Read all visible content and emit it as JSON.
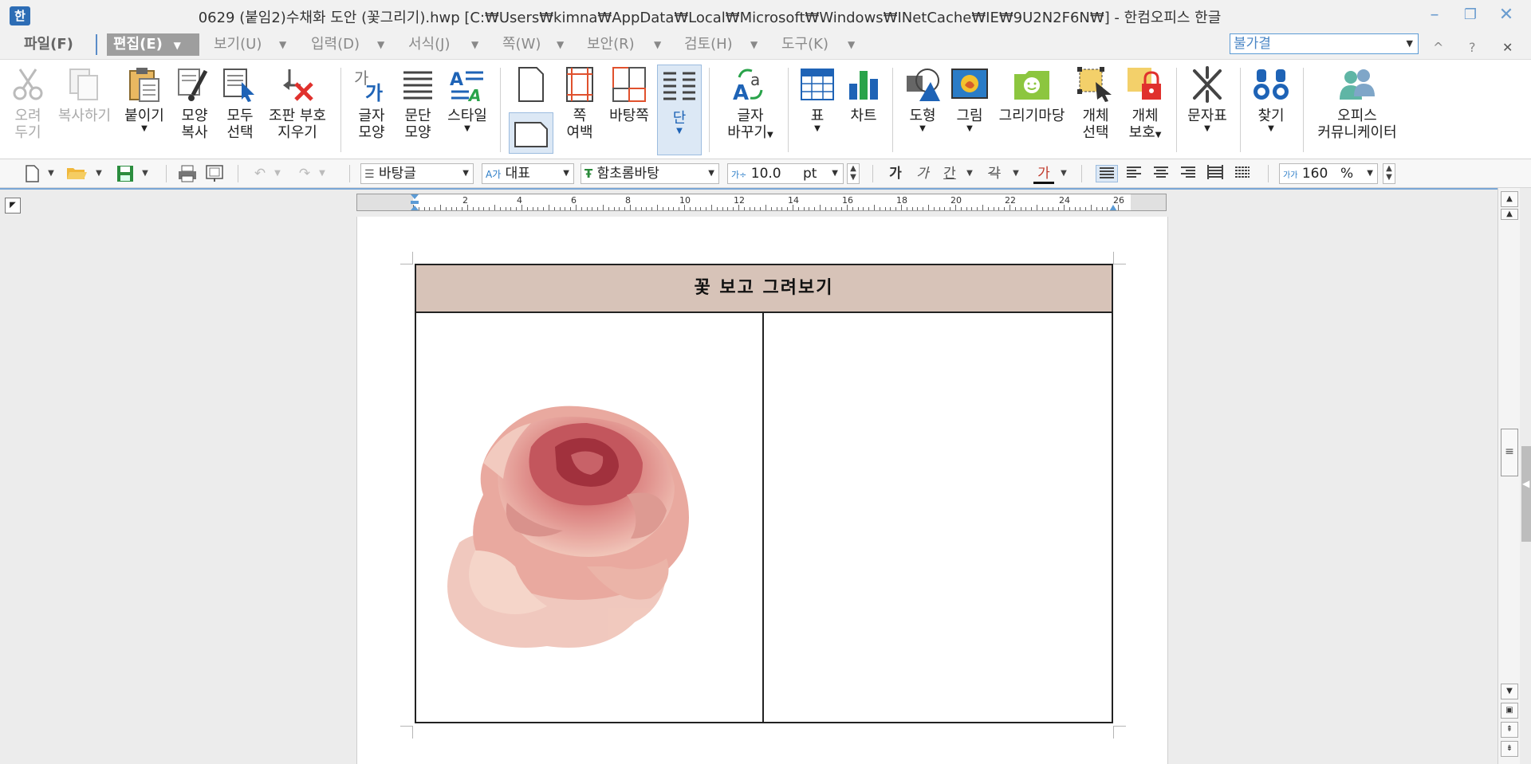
{
  "titlebar": {
    "app_icon": "hwp-app-icon",
    "title": "0629 (붙임2)수채화 도안 (꽃그리기).hwp [C:₩Users₩kimna₩AppData₩Local₩Microsoft₩Windows₩INetCache₩IE₩9U2N2F6N₩] - 한컴오피스 한글",
    "minimize": "–",
    "restore": "❐",
    "close": "✕"
  },
  "menubar": {
    "items": [
      "파일(F)",
      "편집(E)",
      "보기(U)",
      "입력(D)",
      "서식(J)",
      "쪽(W)",
      "보안(R)",
      "검토(H)",
      "도구(K)"
    ],
    "active": "편집(E)",
    "style_combo": "불가결",
    "ribbon_collapse": "^",
    "help": "?",
    "close_doc": "✕"
  },
  "ribbon": {
    "cut": "오려\n두기",
    "copy": "복사하기",
    "paste": "붙이기",
    "format_copy": "모양\n복사",
    "select_all": "모두\n선택",
    "clear_marks": "조판 부호\n지우기",
    "char_shape": "글자\n모양",
    "para_shape": "문단\n모양",
    "style": "스타일",
    "page_margin": "쪽\n여백",
    "background_page": "바탕쪽",
    "column": "단",
    "char_replace": "글자\n바꾸기",
    "table": "표",
    "chart": "차트",
    "shape": "도형",
    "picture": "그림",
    "draw_market": "그리기마당",
    "object_select": "개체\n선택",
    "object_protect": "개체\n보호",
    "symbol": "문자표",
    "find": "찾기",
    "office_communicator": "오피스\n커뮤니케이터"
  },
  "format": {
    "para_style": "바탕글",
    "lang": "대표",
    "font": "함초롬바탕",
    "size": "10.0",
    "size_unit": "pt",
    "bold": "가",
    "italic": "가",
    "underline": "간",
    "strike": "각",
    "font_color": "가",
    "line_spacing": "160",
    "line_spacing_unit": "%"
  },
  "ruler": {
    "labels": [
      "2",
      "4",
      "6",
      "8",
      "10",
      "12",
      "14",
      "16",
      "18",
      "20",
      "22",
      "24",
      "26"
    ]
  },
  "document": {
    "table_header": "꽃 보고 그려보기",
    "image_alt": "watercolor-rose"
  },
  "colors": {
    "header_fill": "#d7c3b8",
    "accent_blue": "#2d6db5",
    "rose_light": "#e9a79c",
    "rose_dark": "#b54a4f"
  }
}
